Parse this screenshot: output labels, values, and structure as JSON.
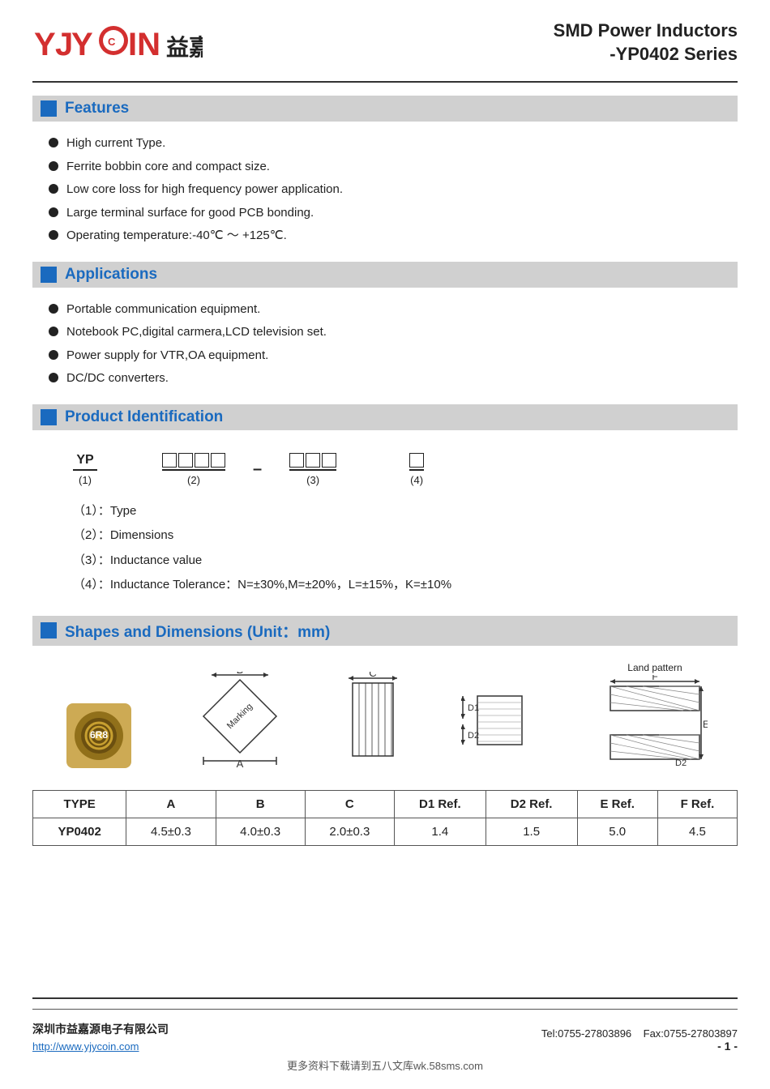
{
  "header": {
    "logo_text": "益嘉源",
    "title_line1": "SMD Power Inductors",
    "title_line2": "-YP0402 Series"
  },
  "sections": {
    "features": {
      "label": "Features",
      "items": [
        "High current Type.",
        "Ferrite bobbin core and compact size.",
        "Low core loss for high frequency power application.",
        "Large terminal surface for good PCB bonding.",
        "Operating temperature:-40℃ ～ +125℃."
      ]
    },
    "applications": {
      "label": "Applications",
      "items": [
        "Portable communication equipment.",
        "Notebook PC,digital carmera,LCD television set.",
        "Power supply for VTR,OA equipment.",
        "DC/DC converters."
      ]
    },
    "product_id": {
      "label": "Product Identification",
      "part1_label": "YP",
      "part1_num": "(1)",
      "part2_boxes": 4,
      "part2_num": "(2)",
      "part3_boxes": 3,
      "part3_num": "(3)",
      "part4_boxes": 1,
      "part4_num": "(4)",
      "details": [
        "（1）：Type",
        "（2）：Dimensions",
        "（3）：Inductance value",
        "（4）：Inductance Tolerance：N=±30%,M=±20%，L=±15%，K=±10%"
      ]
    },
    "shapes": {
      "label": "Shapes and Dimensions (Unit：mm)",
      "land_pattern_label": "Land pattern",
      "table": {
        "headers": [
          "TYPE",
          "A",
          "B",
          "C",
          "D1 Ref.",
          "D2 Ref.",
          "E Ref.",
          "F Ref."
        ],
        "rows": [
          [
            "YP0402",
            "4.5±0.3",
            "4.0±0.3",
            "2.0±0.3",
            "1.4",
            "1.5",
            "5.0",
            "4.5"
          ]
        ]
      }
    }
  },
  "footer": {
    "company": "深圳市益嘉源电子有限公司",
    "website": "http://www.yjycoin.com",
    "tel": "Tel:0755-27803896",
    "fax": "Fax:0755-27803897",
    "page": "- 1 -",
    "watermark": "更多资料下载请到五八文库wk.58sms.com"
  }
}
